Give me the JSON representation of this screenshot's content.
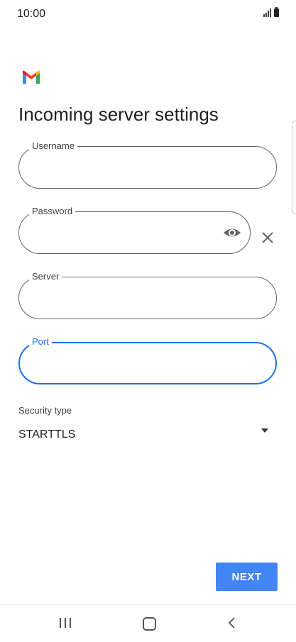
{
  "status_bar": {
    "time": "10:00"
  },
  "title": "Incoming server settings",
  "fields": {
    "username": {
      "label": "Username",
      "value": ""
    },
    "password": {
      "label": "Password",
      "value": ""
    },
    "server": {
      "label": "Server",
      "value": ""
    },
    "port": {
      "label": "Port",
      "value": ""
    }
  },
  "security": {
    "label": "Security type",
    "value": "STARTTLS"
  },
  "next_label": "NEXT",
  "colors": {
    "accent": "#4285f4",
    "focus_border": "#1a73e8",
    "outline": "#5f6368"
  },
  "icons": [
    "gmail-logo-icon",
    "eye-icon",
    "close-icon",
    "dropdown-arrow-icon",
    "recents-icon",
    "home-icon",
    "back-icon"
  ]
}
